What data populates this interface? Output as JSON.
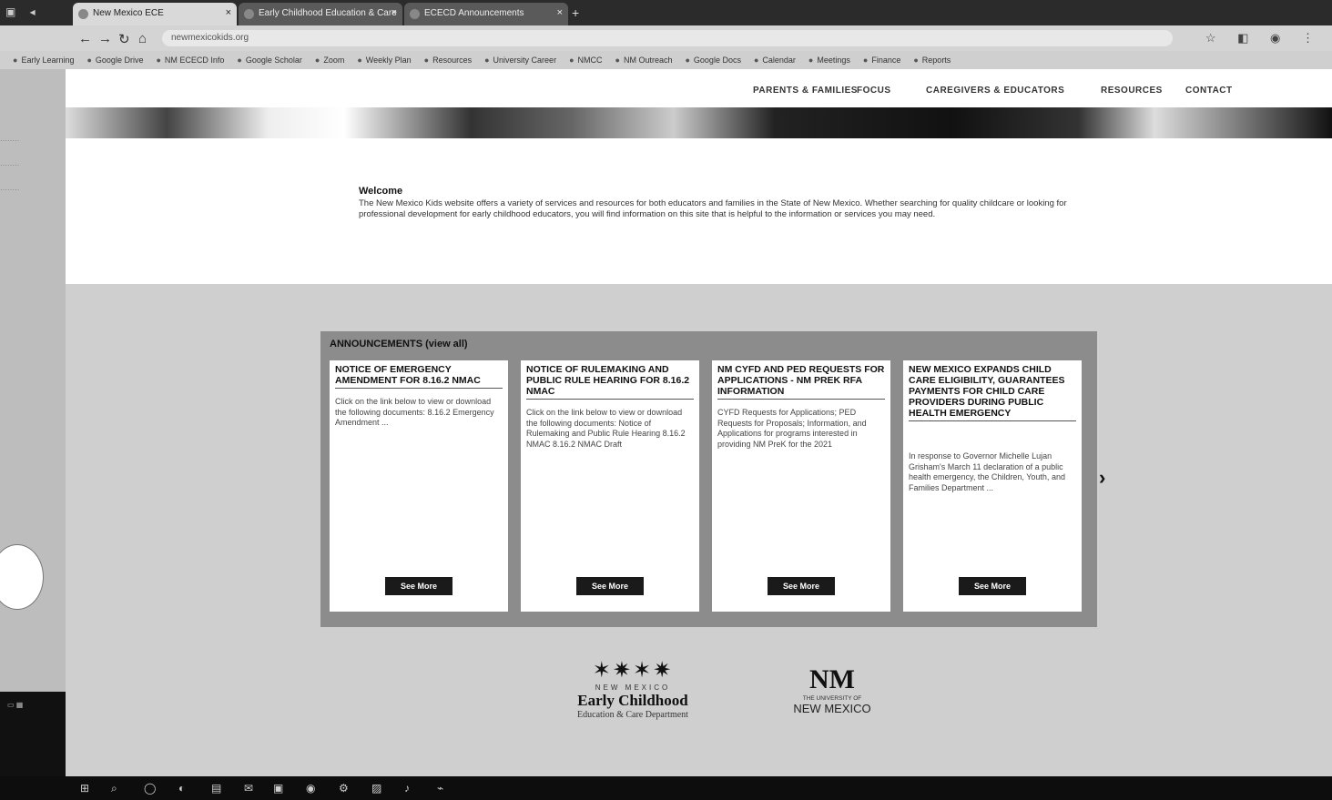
{
  "browser": {
    "tabs": [
      {
        "label": "New Mexico ECE",
        "active": true
      },
      {
        "label": "Early Childhood Education & Care",
        "active": false
      },
      {
        "label": "ECECD Announcements",
        "active": false
      }
    ],
    "url": "newmexicokids.org",
    "bookmarks": [
      "Early Learning",
      "Google Drive",
      "NM ECECD Info",
      "Google Scholar",
      "Zoom",
      "Weekly Plan",
      "Resources",
      "University Career",
      "NMCC",
      "NM Outreach",
      "Google Docs",
      "Calendar",
      "Meetings",
      "Finance",
      "Reports"
    ]
  },
  "site": {
    "nav": [
      "PARENTS & FAMILIES",
      "FOCUS",
      "CAREGIVERS & EDUCATORS",
      "RESOURCES",
      "CONTACT"
    ],
    "welcome_title": "Welcome",
    "welcome_text": "The New Mexico Kids website offers a variety of services and resources for both educators and families in the State of New Mexico. Whether searching for quality childcare or looking for professional development for early childhood educators, you will find information on this site that is helpful to the information or services you may need.",
    "announcements_heading": "ANNOUNCEMENTS (view all)",
    "cards": [
      {
        "title": "NOTICE OF EMERGENCY AMENDMENT FOR 8.16.2 NMAC",
        "body": "Click on the link below to view or download the following documents: 8.16.2 Emergency Amendment ...",
        "button": "See More"
      },
      {
        "title": "NOTICE OF RULEMAKING AND PUBLIC RULE HEARING FOR 8.16.2 NMAC",
        "body": "Click on the link below to view or download the following documents: Notice of Rulemaking and Public Rule Hearing 8.16.2 NMAC 8.16.2 NMAC Draft",
        "button": "See More"
      },
      {
        "title": "NM CYFD AND PED REQUESTS FOR APPLICATIONS - NM PREK RFA INFORMATION",
        "body": "CYFD Requests for Applications; PED Requests for Proposals; Information, and Applications for programs interested in providing NM PreK for the 2021",
        "button": "See More"
      },
      {
        "title": "NEW MEXICO EXPANDS CHILD CARE ELIGIBILITY, GUARANTEES PAYMENTS FOR CHILD CARE PROVIDERS DURING PUBLIC HEALTH EMERGENCY",
        "body": "In response to Governor Michelle Lujan Grisham's March 11 declaration of a public health emergency, the Children, Youth, and Families Department ...",
        "button": "See More"
      }
    ],
    "logos": {
      "necd_state": "NEW MEXICO",
      "necd_name": "Early Childhood",
      "necd_dept": "Education & Care Department",
      "unm_mono": "NM",
      "unm_small": "THE UNIVERSITY OF",
      "unm_big": "NEW MEXICO"
    }
  },
  "taskbar": {
    "icons": [
      "windows-icon",
      "search-icon",
      "taskview-icon",
      "edge-icon",
      "files-icon",
      "mail-icon",
      "store-icon",
      "chrome-icon",
      "settings-icon",
      "photos-icon",
      "music-icon",
      "network-icon"
    ]
  }
}
